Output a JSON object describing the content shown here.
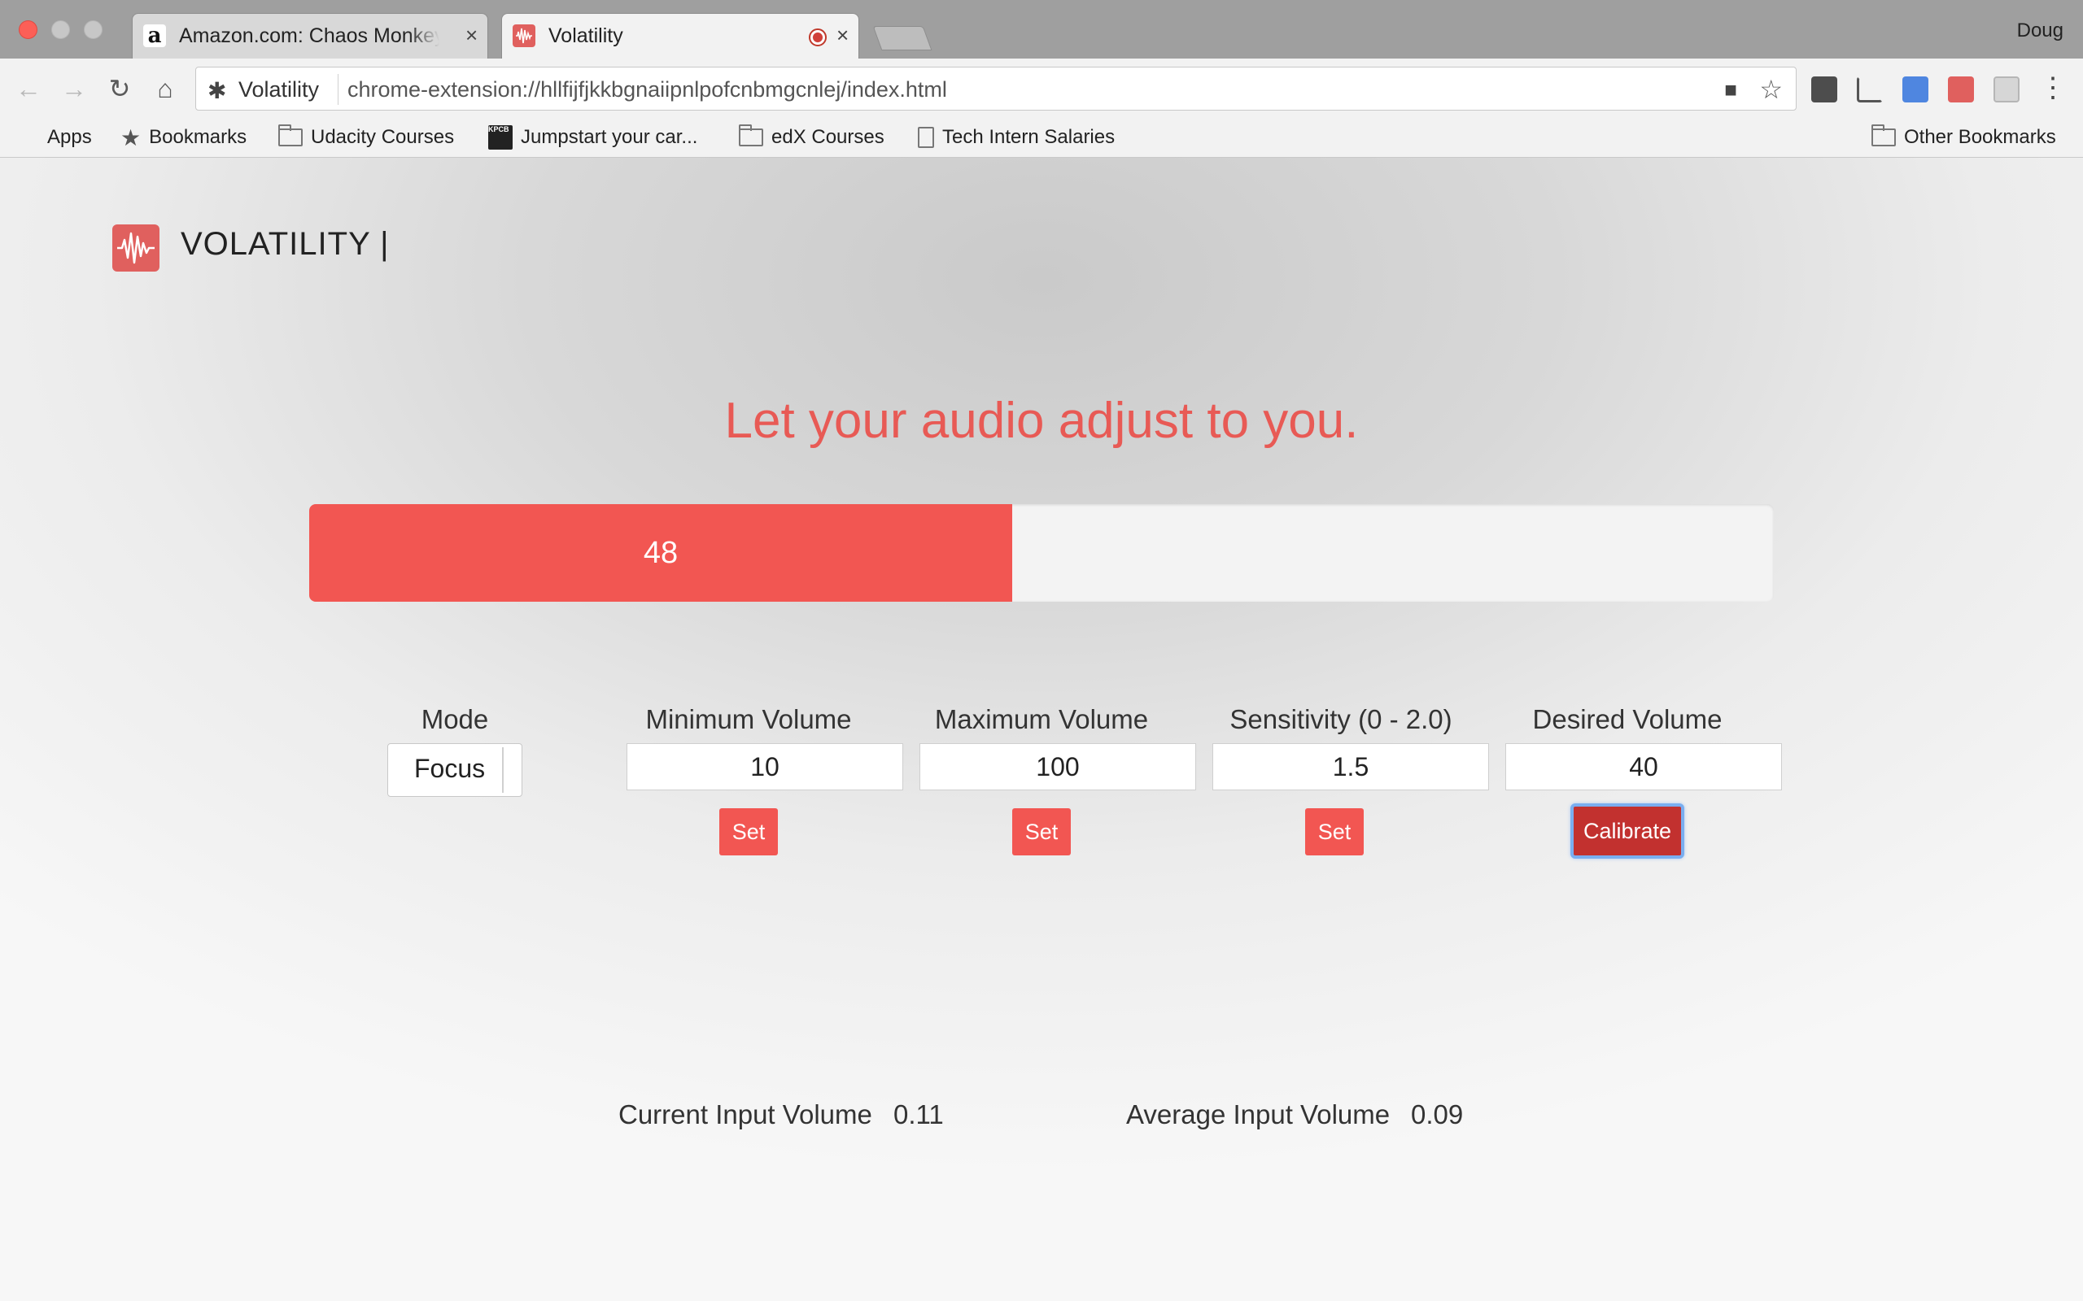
{
  "browser": {
    "tabs": [
      {
        "title": "Amazon.com: Chaos Monkeys: Obscene Fortune and Random Failure in Silicon Valley",
        "favicon": "amazon-icon"
      },
      {
        "title": "Volatility",
        "favicon": "volatility-icon",
        "recording": true
      }
    ],
    "profile": "Doug",
    "omnibox": {
      "site": "Volatility",
      "url": "chrome-extension://hllfijfjkkbgnaiipnlpofcnbmgcnlej/index.html"
    },
    "bookmarks": [
      {
        "label": "Apps",
        "icon": "apps-grid-icon"
      },
      {
        "label": "Bookmarks",
        "icon": "star-icon"
      },
      {
        "label": "Udacity Courses",
        "icon": "folder-icon"
      },
      {
        "label": "Jumpstart your car...",
        "icon": "kpcb-icon"
      },
      {
        "label": "edX Courses",
        "icon": "folder-icon"
      },
      {
        "label": "Tech Intern Salaries",
        "icon": "page-icon"
      },
      {
        "label": "Other Bookmarks",
        "icon": "folder-icon"
      }
    ],
    "kpcb_text": "KPCB"
  },
  "app": {
    "brand": "VOLATILITY |",
    "tagline": "Let your audio adjust to you.",
    "accent": "#f25652",
    "volume": {
      "value": "48",
      "fraction": 0.48
    }
  },
  "controls": {
    "mode": {
      "label": "Mode",
      "value": "Focus"
    },
    "min_volume": {
      "label": "Minimum Volume",
      "value": "10",
      "button": "Set"
    },
    "max_volume": {
      "label": "Maximum Volume",
      "value": "100",
      "button": "Set"
    },
    "sensitivity": {
      "label": "Sensitivity (0 - 2.0)",
      "value": "1.5",
      "button": "Set"
    },
    "desired_volume": {
      "label": "Desired Volume",
      "value": "40",
      "button": "Calibrate"
    }
  },
  "stats": {
    "current_label": "Current Input Volume",
    "current_value": "0.11",
    "average_label": "Average Input Volume",
    "average_value": "0.09"
  }
}
